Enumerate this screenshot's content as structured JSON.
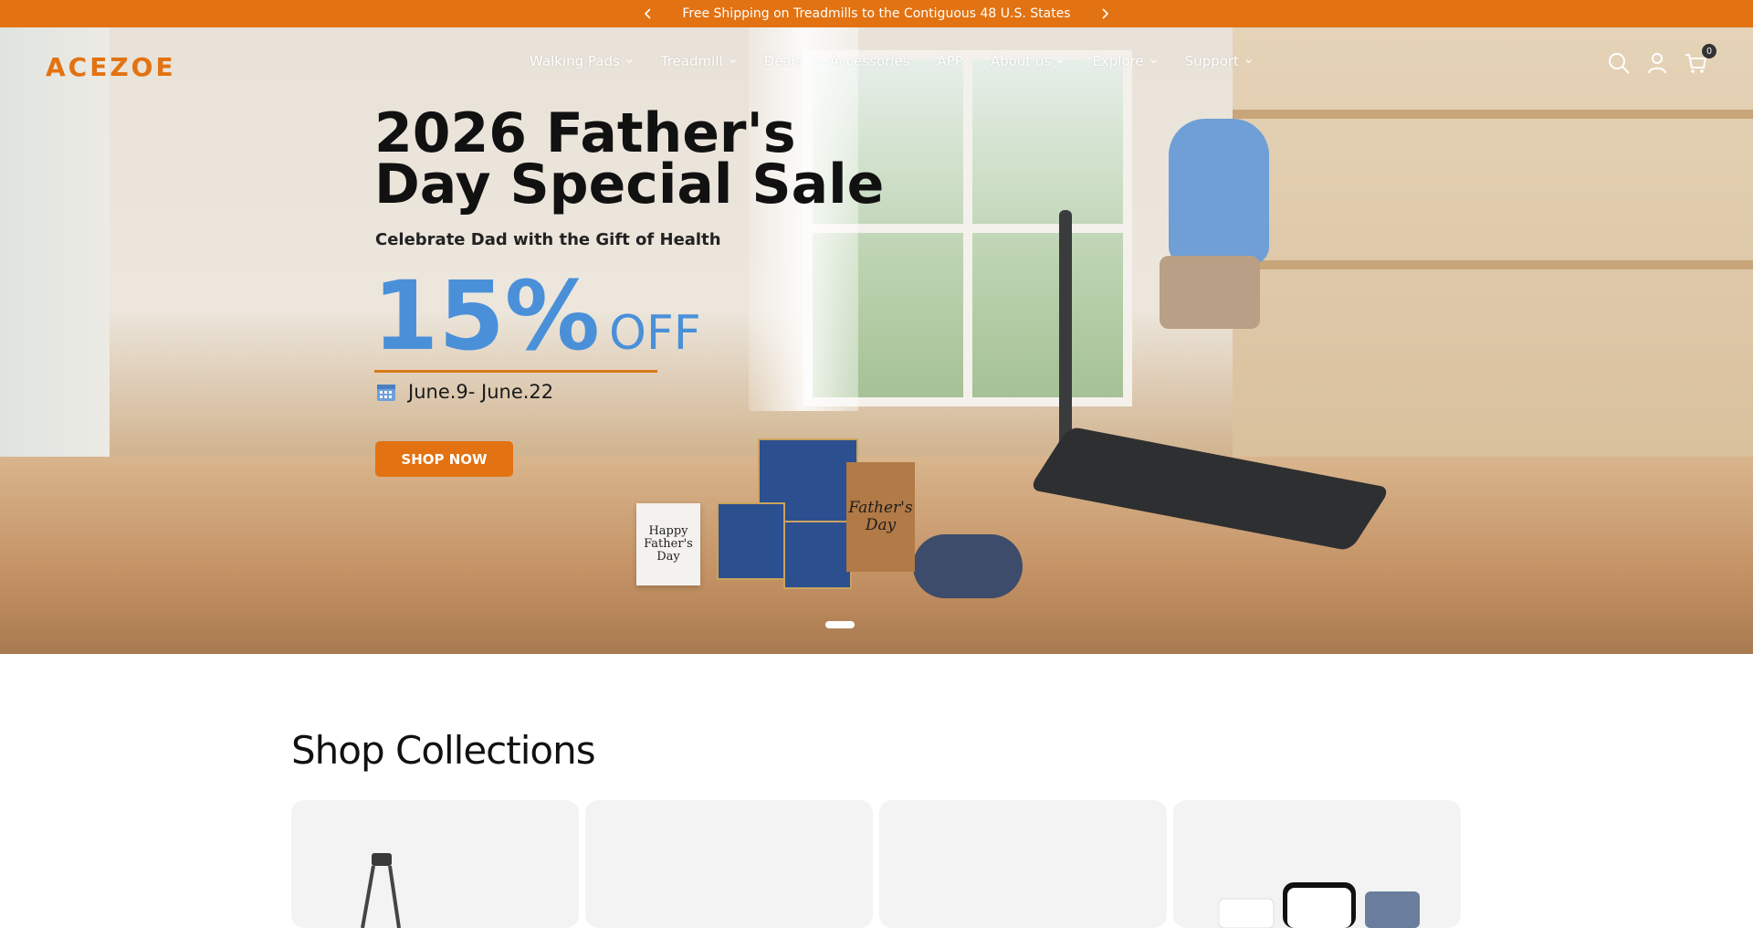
{
  "announcement": {
    "text": "Free Shipping on Treadmills to the Contiguous 48 U.S. States",
    "prev_icon": "chevron-left-icon",
    "next_icon": "chevron-right-icon"
  },
  "header": {
    "logo": "ACEZOE",
    "nav": [
      {
        "label": "Walking Pads",
        "has_dropdown": true
      },
      {
        "label": "Treadmill",
        "has_dropdown": true
      },
      {
        "label": "Deals",
        "has_dropdown": false
      },
      {
        "label": "Accessories",
        "has_dropdown": false
      },
      {
        "label": "APP",
        "has_dropdown": false
      },
      {
        "label": "About us",
        "has_dropdown": true
      },
      {
        "label": "Explore",
        "has_dropdown": true
      },
      {
        "label": "Support",
        "has_dropdown": true
      }
    ],
    "icons": [
      "search-icon",
      "account-icon",
      "cart-icon"
    ],
    "cart_count": "0"
  },
  "hero": {
    "title_line1": "2026 Father's",
    "title_line2": "Day Special Sale",
    "subtitle": "Celebrate Dad with the Gift of Health",
    "discount": "15%",
    "discount_suffix": "OFF",
    "dates": "June.9- June.22",
    "cta": "SHOP NOW",
    "card_text": [
      "Happy",
      "Father's",
      "Day"
    ],
    "bag_text": [
      "Father's",
      "Day"
    ],
    "slides": 1,
    "active_slide": 1
  },
  "collections": {
    "title": "Shop Collections",
    "cards": 4
  },
  "colors": {
    "accent": "#e27212",
    "discount_blue": "#4a90d9"
  }
}
